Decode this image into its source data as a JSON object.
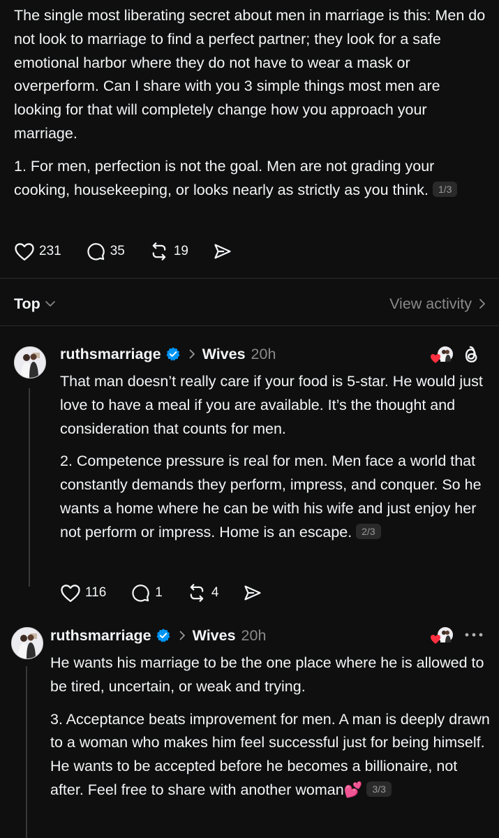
{
  "main_post": {
    "paragraphs": [
      "The single most liberating secret about men in marriage is this: Men do not look to marriage to find a perfect partner; they look for a safe emotional harbor where they do not have to wear a mask or overperform. Can I share with you 3 simple things most men are looking for that will completely change how you approach your marriage.",
      "1. For men, perfection is not the goal. Men are not grading your cooking, housekeeping, or looks nearly as strictly as you think."
    ],
    "counter": "1/3",
    "likes": "231",
    "replies": "35",
    "reposts": "19"
  },
  "sort_bar": {
    "label": "Top",
    "view_activity": "View activity"
  },
  "replies": [
    {
      "username": "ruthsmarriage",
      "community": "Wives",
      "time": "20h",
      "paragraphs": [
        "That man doesn’t really care if your food is 5-star. He would just love to have a meal if you are available. It’s the thought and consideration that counts for men.",
        "2. Competence pressure is real for men. Men face a world that constantly demands they perform, impress, and conquer. So he wants a home where he can be with his wife and just enjoy her not perform or impress. Home is an escape."
      ],
      "counter": "2/3",
      "likes": "116",
      "replies": "1",
      "reposts": "4"
    },
    {
      "username": "ruthsmarriage",
      "community": "Wives",
      "time": "20h",
      "paragraphs": [
        "He wants his marriage to be the one place where he is allowed to be tired, uncertain, or weak and trying.",
        "3. Acceptance beats improvement for men. A man is deeply drawn to a woman who makes him feel successful just for being himself. He wants to be accepted before he becomes a billionaire, not after. Feel free to share with another woman💕"
      ],
      "counter": "3/3"
    }
  ],
  "icons": {
    "like": "heart-icon",
    "reply": "comment-icon",
    "repost": "repost-icon",
    "share": "send-icon",
    "verified": "verified-badge-icon",
    "threads": "threads-logo-icon",
    "more": "more-icon"
  },
  "colors": {
    "background": "#0f0f0f",
    "text": "#f3f5f7",
    "muted": "#8a8a8a",
    "verified": "#0095f6",
    "like_heart": "#ff3040"
  }
}
